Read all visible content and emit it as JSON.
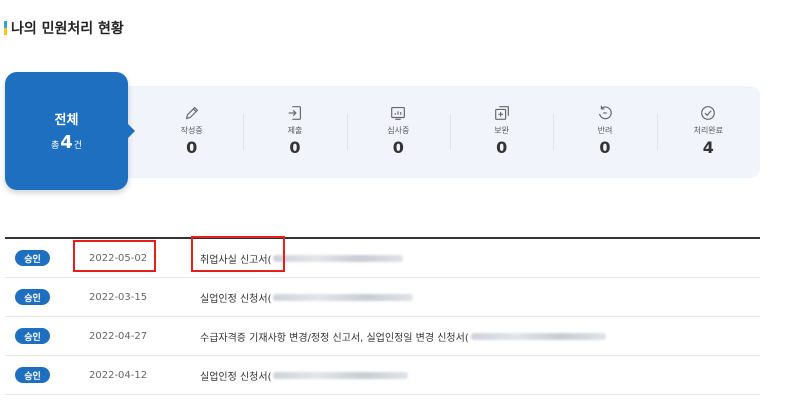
{
  "page": {
    "title": "나의 민원처리 현황"
  },
  "summary": {
    "label": "전체",
    "prefix": "총",
    "count": "4",
    "suffix": "건"
  },
  "statuses": [
    {
      "icon": "pencil-icon",
      "label": "작성중",
      "value": "0"
    },
    {
      "icon": "submit-icon",
      "label": "제출",
      "value": "0"
    },
    {
      "icon": "review-icon",
      "label": "심사중",
      "value": "0"
    },
    {
      "icon": "supplement-icon",
      "label": "보완",
      "value": "0"
    },
    {
      "icon": "return-icon",
      "label": "반려",
      "value": "0"
    },
    {
      "icon": "check-circle-icon",
      "label": "처리완료",
      "value": "4"
    }
  ],
  "rows": [
    {
      "status": "승인",
      "date": "2022-05-02",
      "doc": "취업사실 신고서("
    },
    {
      "status": "승인",
      "date": "2022-03-15",
      "doc": "실업인정 신청서("
    },
    {
      "status": "승인",
      "date": "2022-04-27",
      "doc": "수급자격증 기재사항 변경/정정 신고서, 실업인정일 변경 신청서("
    },
    {
      "status": "승인",
      "date": "2022-04-12",
      "doc": "실업인정 신청서("
    }
  ],
  "colors": {
    "accent": "#1e6fc0",
    "strip": "#f1f5fb",
    "highlight": "#e61e1e"
  }
}
